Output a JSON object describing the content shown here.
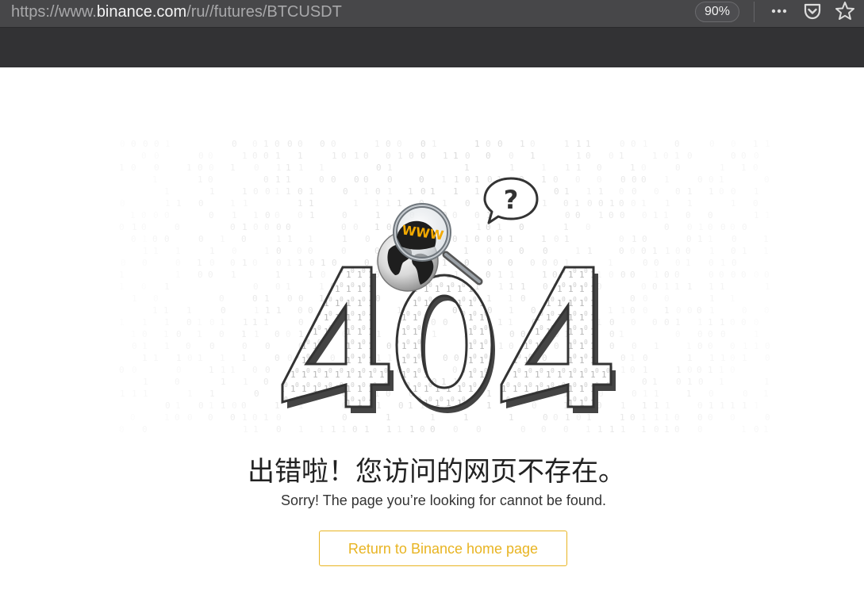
{
  "browser": {
    "url_prefix": "https://www.",
    "url_domain": "binance.com",
    "url_path": "/ru//futures/BTCUSDT",
    "zoom": "90%",
    "icons": [
      "more-actions-icon",
      "pocket-icon",
      "bookmark-star-icon"
    ]
  },
  "illustration": {
    "code": "404",
    "globe_label": "WWW",
    "bubble_symbol": "?"
  },
  "error": {
    "title_zh": "出错啦！您访问的网页不存在。",
    "subtitle": "Sorry! The page you’re looking for cannot be found.",
    "home_button": "Return to Binance home page"
  },
  "colors": {
    "accent": "#e8b422",
    "chrome_dark": "#323234",
    "url_bar": "#474749"
  }
}
